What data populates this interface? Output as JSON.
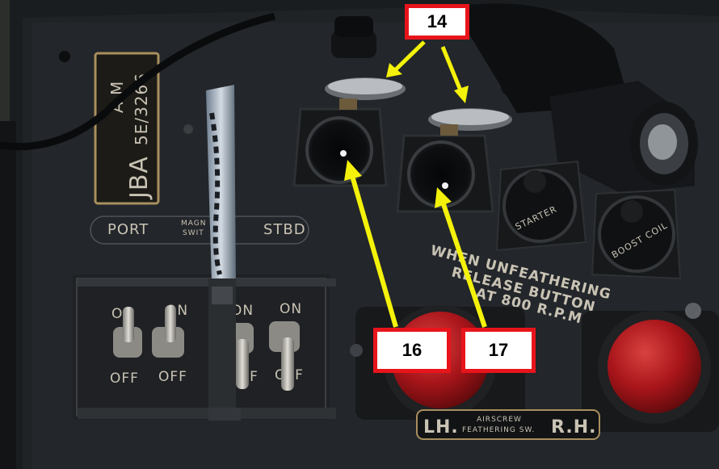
{
  "panel": {
    "placard_line1": "A M",
    "placard_line2": "JBA",
    "placard_line3": "5E/3266",
    "port_label": "PORT",
    "stbd_label": "STBD",
    "magneto_label_line1": "MAGN",
    "magneto_label_line2": "SWIT",
    "switch_on_label": "ON",
    "switch_off_label": "OFF",
    "starter_label": "STARTER",
    "boost_coil_label": "BOOST COIL",
    "unfeather_line1": "WHEN UNFEATHERING",
    "unfeather_line2": "RELEASE BUTTON",
    "unfeather_line3": "AT 800 R.P.M.",
    "feather_lh": "LH.",
    "feather_rh": "R.H.",
    "feather_mid_line1": "AIRSCREW",
    "feather_mid_line2": "FEATHERING SW."
  },
  "callouts": {
    "c14": "14",
    "c16": "16",
    "c17": "17"
  },
  "colors": {
    "callout_border": "#e8141b",
    "arrow": "#f4f20a",
    "feather_button": "#a8151a"
  }
}
